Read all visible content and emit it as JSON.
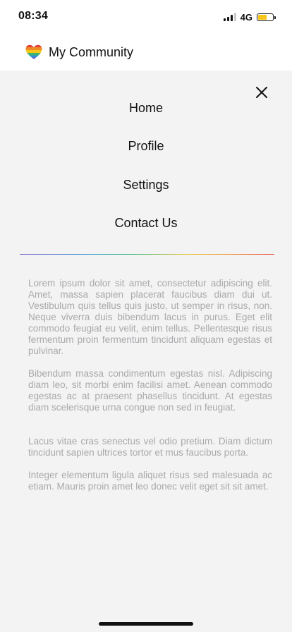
{
  "status_bar": {
    "time": "08:34",
    "network": "4G",
    "signal_bars_active": 3,
    "battery_level": 0.6,
    "battery_color": "#f5c518"
  },
  "app": {
    "title": "My Community",
    "logo_icon": "rainbow-heart-icon"
  },
  "menu": {
    "close_icon": "close-icon",
    "items": [
      {
        "label": "Home"
      },
      {
        "label": "Profile"
      },
      {
        "label": "Settings"
      },
      {
        "label": "Contact Us"
      }
    ]
  },
  "content": {
    "paragraphs": [
      "Lorem ipsum dolor sit amet, consectetur adipiscing elit. Amet, massa sapien placerat faucibus diam dui ut. Vestibulum quis tellus quis justo, ut semper in risus, non. Neque viverra duis bibendum lacus in purus. Eget elit commodo feugiat eu velit, enim tellus. Pellentesque risus fermentum proin fermentum tincidunt aliquam egestas et pulvinar.",
      "Bibendum massa condimentum egestas nisl. Adipiscing diam leo, sit morbi enim facilisi amet. Aenean commodo egestas ac at praesent phasellus tincidunt. At egestas diam scelerisque urna congue non sed in feugiat.",
      "Lacus vitae cras senectus vel odio pretium. Diam dictum tincidunt sapien ultrices tortor et mus faucibus porta.",
      "Integer elementum ligula aliquet risus sed malesuada ac etiam. Mauris proin amet leo donec velit eget sit sit amet."
    ]
  },
  "colors": {
    "panel_background": "#f3f3f4",
    "body_text": "#a9a9ab",
    "divider_gradient": [
      "#7b5ac4",
      "#2f8ed9",
      "#2bb673",
      "#e3c12a",
      "#f08a24",
      "#e2403a"
    ]
  }
}
